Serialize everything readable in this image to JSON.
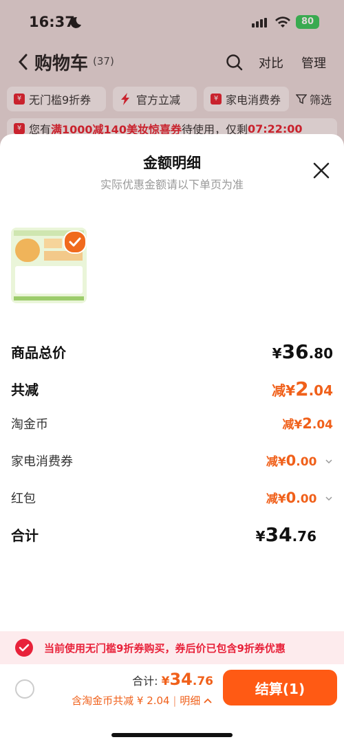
{
  "status_bar": {
    "time": "16:37",
    "battery": "80"
  },
  "cart_header": {
    "title": "购物车",
    "count": "(37)",
    "compare": "对比",
    "manage": "管理"
  },
  "chips": [
    {
      "label": "无门槛9折券"
    },
    {
      "label": "官方立减"
    },
    {
      "label": "家电消费券"
    }
  ],
  "filter": "筛选",
  "notice": {
    "prefix": "您有",
    "highlight": "满1000减140美妆惊喜券",
    "middle": "待使用，仅剩",
    "countdown": "07:22:00"
  },
  "sheet": {
    "title": "金额明细",
    "subtitle": "实际优惠金额请以下单页为准",
    "rows": [
      {
        "label": "商品总价",
        "prefix": "",
        "main": "36",
        "dec": ".80"
      },
      {
        "label": "共减",
        "prefix": "减",
        "main": "2",
        "dec": ".04"
      },
      {
        "label": "淘金币",
        "prefix": "减",
        "main": "2",
        "dec": ".04"
      },
      {
        "label": "家电消费券",
        "prefix": "减",
        "main": "0",
        "dec": ".00"
      },
      {
        "label": "红包",
        "prefix": "减",
        "main": "0",
        "dec": ".00"
      },
      {
        "label": "合计",
        "prefix": "",
        "main": "34",
        "dec": ".76"
      }
    ],
    "currency": "¥"
  },
  "promo_text": "当前使用无门槛9折券购买，券后价已包含9折券优惠",
  "bottom": {
    "total_label": "合计:",
    "total_currency": "¥",
    "total_main": "34",
    "total_dec": ".76",
    "discount_text": "含淘金币共减 ¥ 2.04",
    "detail_label": "明细",
    "checkout": "结算(1)"
  },
  "colors": {
    "accent": "#f0601a",
    "brand_red": "#e4222f",
    "checkout": "#ff5a14"
  }
}
